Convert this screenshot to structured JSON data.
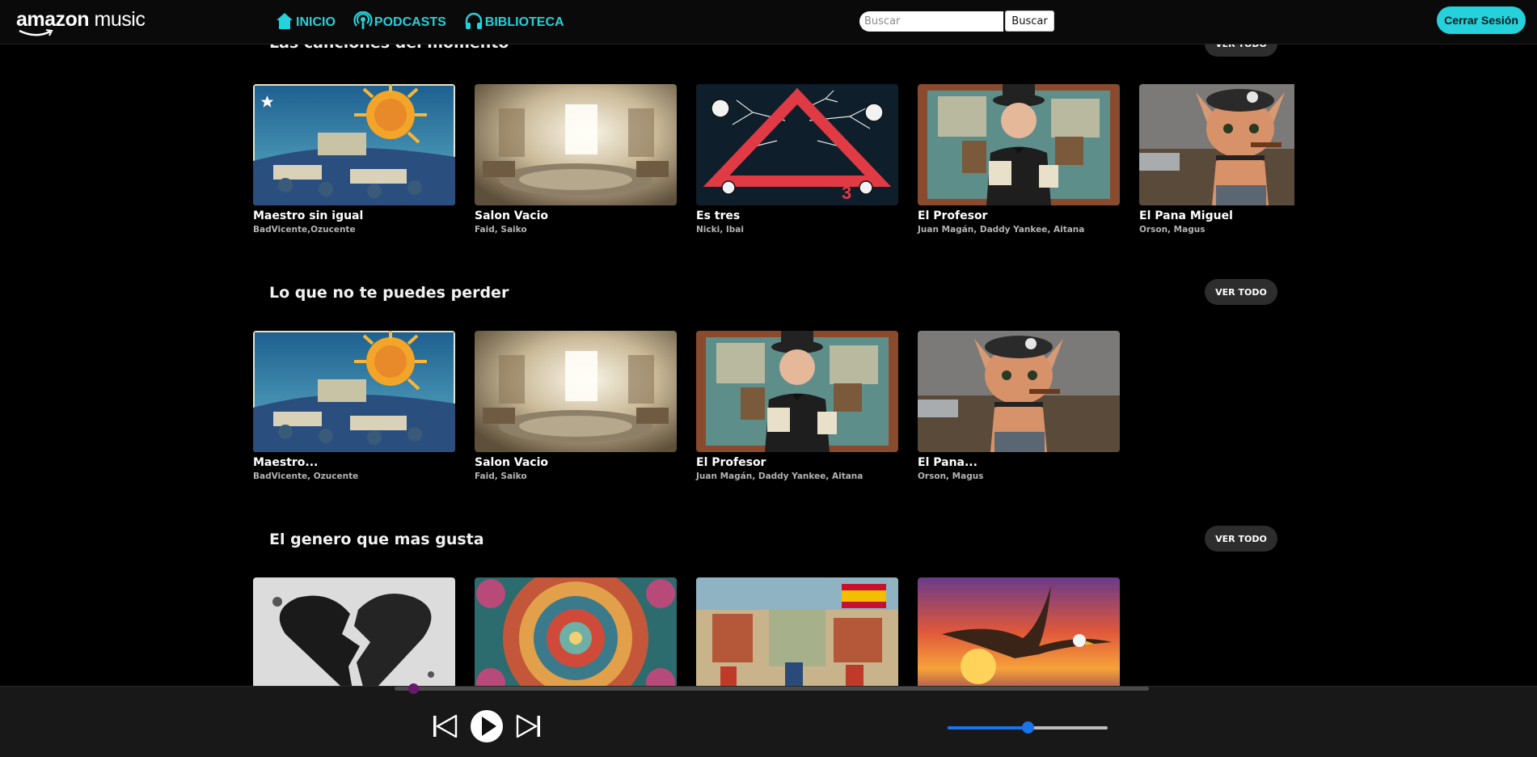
{
  "header": {
    "logo_main": "amazon",
    "logo_sub": " music",
    "nav": [
      {
        "label": "INICIO",
        "icon": "home-icon"
      },
      {
        "label": "PODCASTS",
        "icon": "podcast-icon"
      },
      {
        "label": "BIBLIOTECA",
        "icon": "headphones-icon"
      }
    ],
    "search_placeholder": "Buscar",
    "search_button": "Buscar",
    "logout": "Cerrar Sesión",
    "accent": "#25d1da"
  },
  "sections": [
    {
      "title": "Las canciones del momento",
      "button": "VER TODO",
      "cards": [
        {
          "title": "Maestro sin igual",
          "artists": "BadVicente,Ozucente"
        },
        {
          "title": "Salon Vacio",
          "artists": "Faid, Saiko"
        },
        {
          "title": "Es tres",
          "artists": "Nicki, Ibai"
        },
        {
          "title": "El Profesor",
          "artists": "Juan Magán, Daddy Yankee, Aitana"
        },
        {
          "title": "El Pana Miguel",
          "artists": "Orson, Magus"
        }
      ]
    },
    {
      "title": "Lo que no te puedes perder",
      "button": "VER TODO",
      "cards": [
        {
          "title": "Maestro...",
          "artists": "BadVicente, Ozucente"
        },
        {
          "title": "Salon Vacio",
          "artists": "Faid, Saiko"
        },
        {
          "title": "El Profesor",
          "artists": "Juan Magán, Daddy Yankee, Aitana"
        },
        {
          "title": "El Pana...",
          "artists": "Orson, Magus"
        }
      ]
    },
    {
      "title": "El genero que mas gusta",
      "button": "VER TODO",
      "cards": [
        {
          "image": "broken-heart"
        },
        {
          "image": "mandala"
        },
        {
          "image": "spanish-festival"
        },
        {
          "image": "eagle-sunset"
        }
      ]
    }
  ],
  "player": {
    "progress": 0.025,
    "volume": 0.5,
    "progress_color": "#6b176b",
    "volume_color": "#1a73e8"
  }
}
